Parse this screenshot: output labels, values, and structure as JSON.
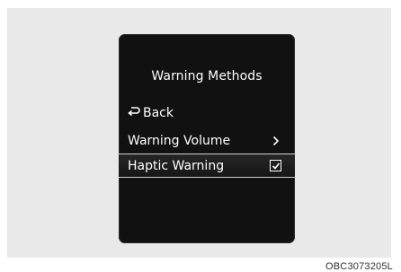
{
  "screen": {
    "title": "Warning Methods",
    "back_label": "Back",
    "items": [
      {
        "label": "Warning Volume",
        "icon": "chevron-right-icon"
      },
      {
        "label": "Haptic Warning",
        "icon": "checkbox-checked-icon",
        "checked": true
      }
    ]
  },
  "figure_code": "OBC3073205L",
  "colors": {
    "background": "#e9e9e9",
    "screen": "#111111",
    "text": "#ffffff"
  }
}
